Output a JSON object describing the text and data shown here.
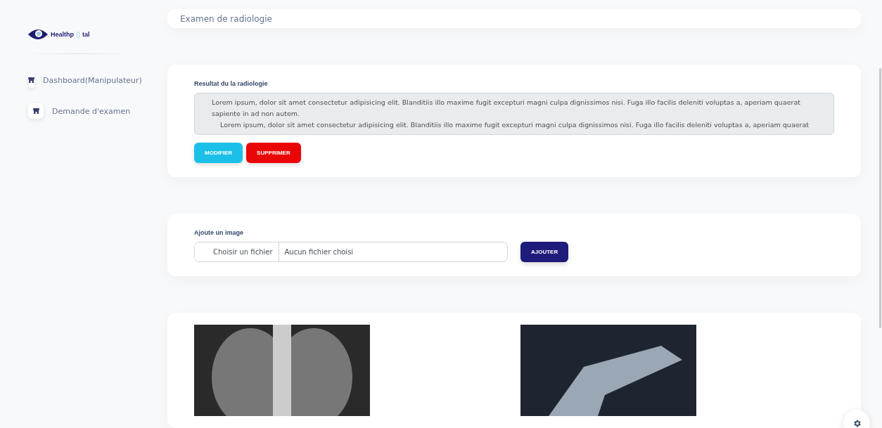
{
  "logo": {
    "parts": [
      "Healthp",
      "tal"
    ]
  },
  "sidebar": {
    "items": [
      {
        "label": "Dashboard(Manipulateur)"
      },
      {
        "label": "Demande d'examen"
      }
    ]
  },
  "header": {
    "title": "Examen de radiologie"
  },
  "result": {
    "label": "Resultat du la radiologie",
    "paragraphs": [
      "Lorem ipsum, dolor sit amet consectetur adipisicing elit. Blanditiis illo maxime fugit excepturi magni culpa dignissimos nisi. Fuga illo facilis deleniti voluptas a, aperiam quaerat sapiente in ad non autem.",
      "Lorem ipsum, dolor sit amet consectetur adipisicing elit. Blanditiis illo maxime fugit excepturi magni culpa dignissimos nisi. Fuga illo facilis deleniti voluptas a, aperiam quaerat"
    ],
    "buttons": [
      {
        "label": "MODIFIER",
        "kind": "edit"
      },
      {
        "label": "SUPPRIMER",
        "kind": "delete"
      }
    ]
  },
  "upload": {
    "label": "Ajoute un image",
    "choose": "Choisir un fichier",
    "file_name": "Aucun fichier choisi",
    "button": "AJOUTER"
  },
  "gallery": {
    "images": [
      {
        "kind": "chest"
      },
      {
        "kind": "hand"
      }
    ]
  }
}
